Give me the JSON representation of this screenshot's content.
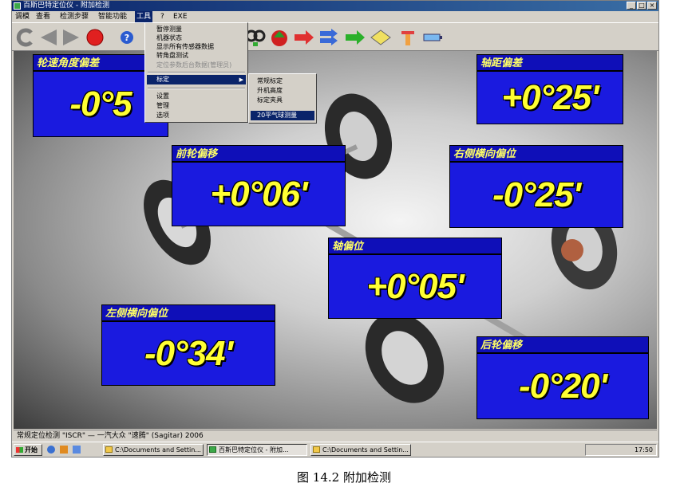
{
  "window": {
    "title": "百斯巴特定位仪 - 附加检测",
    "controls": [
      "_",
      "□",
      "×"
    ]
  },
  "menu": {
    "items": [
      "调模",
      "查看",
      "检测步骤",
      "智能功能",
      "工具",
      "?",
      "EXE"
    ],
    "open_index": 4
  },
  "tools_menu": {
    "items": [
      "暂停测量",
      "机器状态",
      "显示所有传感器数据",
      "转角盘测试",
      "定位参数后台数据(管理员)",
      "标定",
      "设置",
      "管理",
      "选项"
    ],
    "disabled_index": 4,
    "selected_index": 5
  },
  "submenu": {
    "items": [
      "常规标定",
      "升机高度",
      "标定夹具",
      "20平气球测量"
    ]
  },
  "toolbar": {
    "icons": [
      "back-arrow-icon",
      "left-triangle-icon",
      "right-triangle-icon",
      "stop-icon",
      "help-icon",
      "wheel-icon",
      "apple-icon",
      "red-arrow-icon",
      "blue-arrow-icon",
      "green-arrow-icon",
      "diamond-icon",
      "tool-icon",
      "battery-icon"
    ]
  },
  "readings": {
    "toe_diff": {
      "label": "轮速角度偏差",
      "value": "-0°5"
    },
    "wheelbase_diff": {
      "label": "轴距偏差",
      "value": "+0°25'"
    },
    "front_offset": {
      "label": "前轮偏移",
      "value": "+0°06'"
    },
    "right_lateral": {
      "label": "右侧横向偏位",
      "value": "-0°25'"
    },
    "axle_offset": {
      "label": "轴偏位",
      "value": "+0°05'"
    },
    "left_lateral": {
      "label": "左侧横向偏位",
      "value": "-0°34'"
    },
    "rear_offset": {
      "label": "后轮偏移",
      "value": "-0°20'"
    }
  },
  "status_bar": {
    "text": "常规定位检测 \"ISCR\" — 一汽大众 \"速腾\" (Sagitar) 2006"
  },
  "taskbar": {
    "start": "开始",
    "tasks": [
      "C:\\Documents and Settin...",
      "百斯巴特定位仪 - 附加...",
      "C:\\Documents and Settin..."
    ],
    "active_index": 1,
    "clock": "17:50"
  },
  "caption": "图 14.2  附加检测"
}
